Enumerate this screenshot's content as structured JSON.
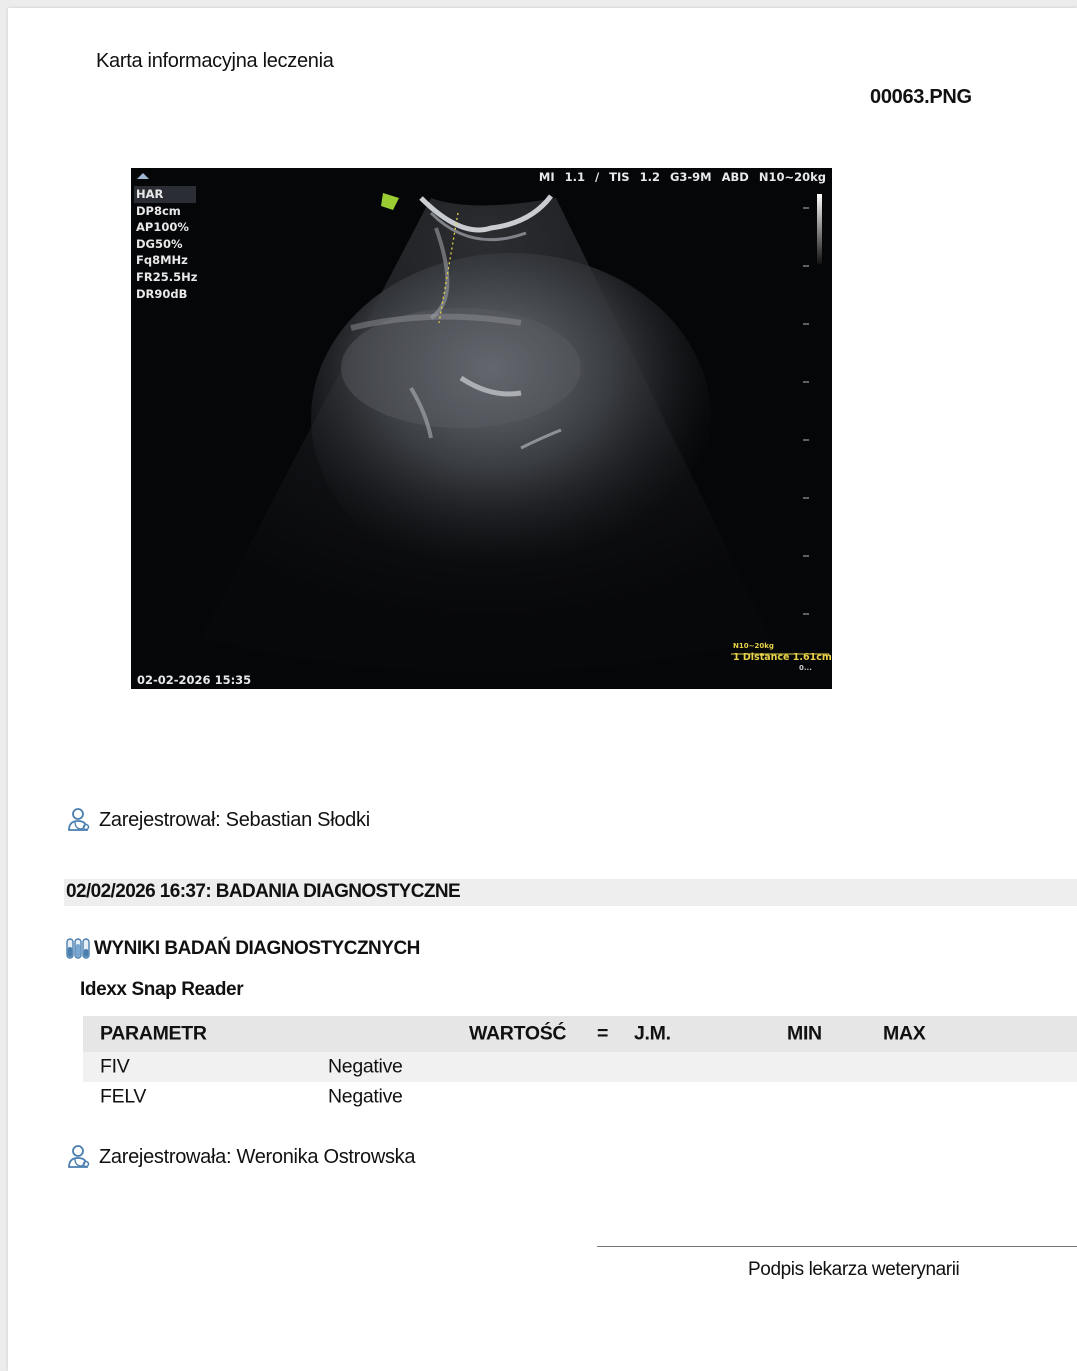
{
  "document": {
    "title": "Karta informacyjna leczenia",
    "file_name": "00063.PNG"
  },
  "ultrasound": {
    "params": [
      "HAR",
      "DP8cm",
      "AP100%",
      "DG50%",
      "Fq8MHz",
      "FR25.5Hz",
      "DR90dB"
    ],
    "header": "MI 1.1 / TIS 1.2  G3-9M  ABD N10~20kg",
    "datetime": "02-02-2026 15:35",
    "measurement_preset": "N10~20kg",
    "measurement": "1 Distance 1.61cm",
    "measurement_sub": "0..."
  },
  "registered_1": {
    "text": "Zarejestrował: Sebastian Słodki"
  },
  "section": {
    "title": "02/02/2026 16:37: BADANIA DIAGNOSTYCZNE"
  },
  "results": {
    "title": "WYNIKI BADAŃ DIAGNOSTYCZNYCH",
    "test_name": "Idexx Snap Reader",
    "columns": {
      "param": "PARAMETR",
      "value": "WARTOŚĆ",
      "eq": "=",
      "unit": "J.M.",
      "min": "MIN",
      "max": "MAX"
    },
    "rows": [
      {
        "param": "FIV",
        "value": "Negative"
      },
      {
        "param": "FELV",
        "value": "Negative"
      }
    ]
  },
  "registered_2": {
    "text": "Zarejestrowała: Weronika Ostrowska"
  },
  "signature": {
    "label": "Podpis lekarza weterynarii"
  },
  "colors": {
    "section_bar": "#eeeeee",
    "table_header": "#e6e6e6",
    "icon_blue": "#4a7fb0",
    "measure_yellow": "#e8d24a"
  }
}
